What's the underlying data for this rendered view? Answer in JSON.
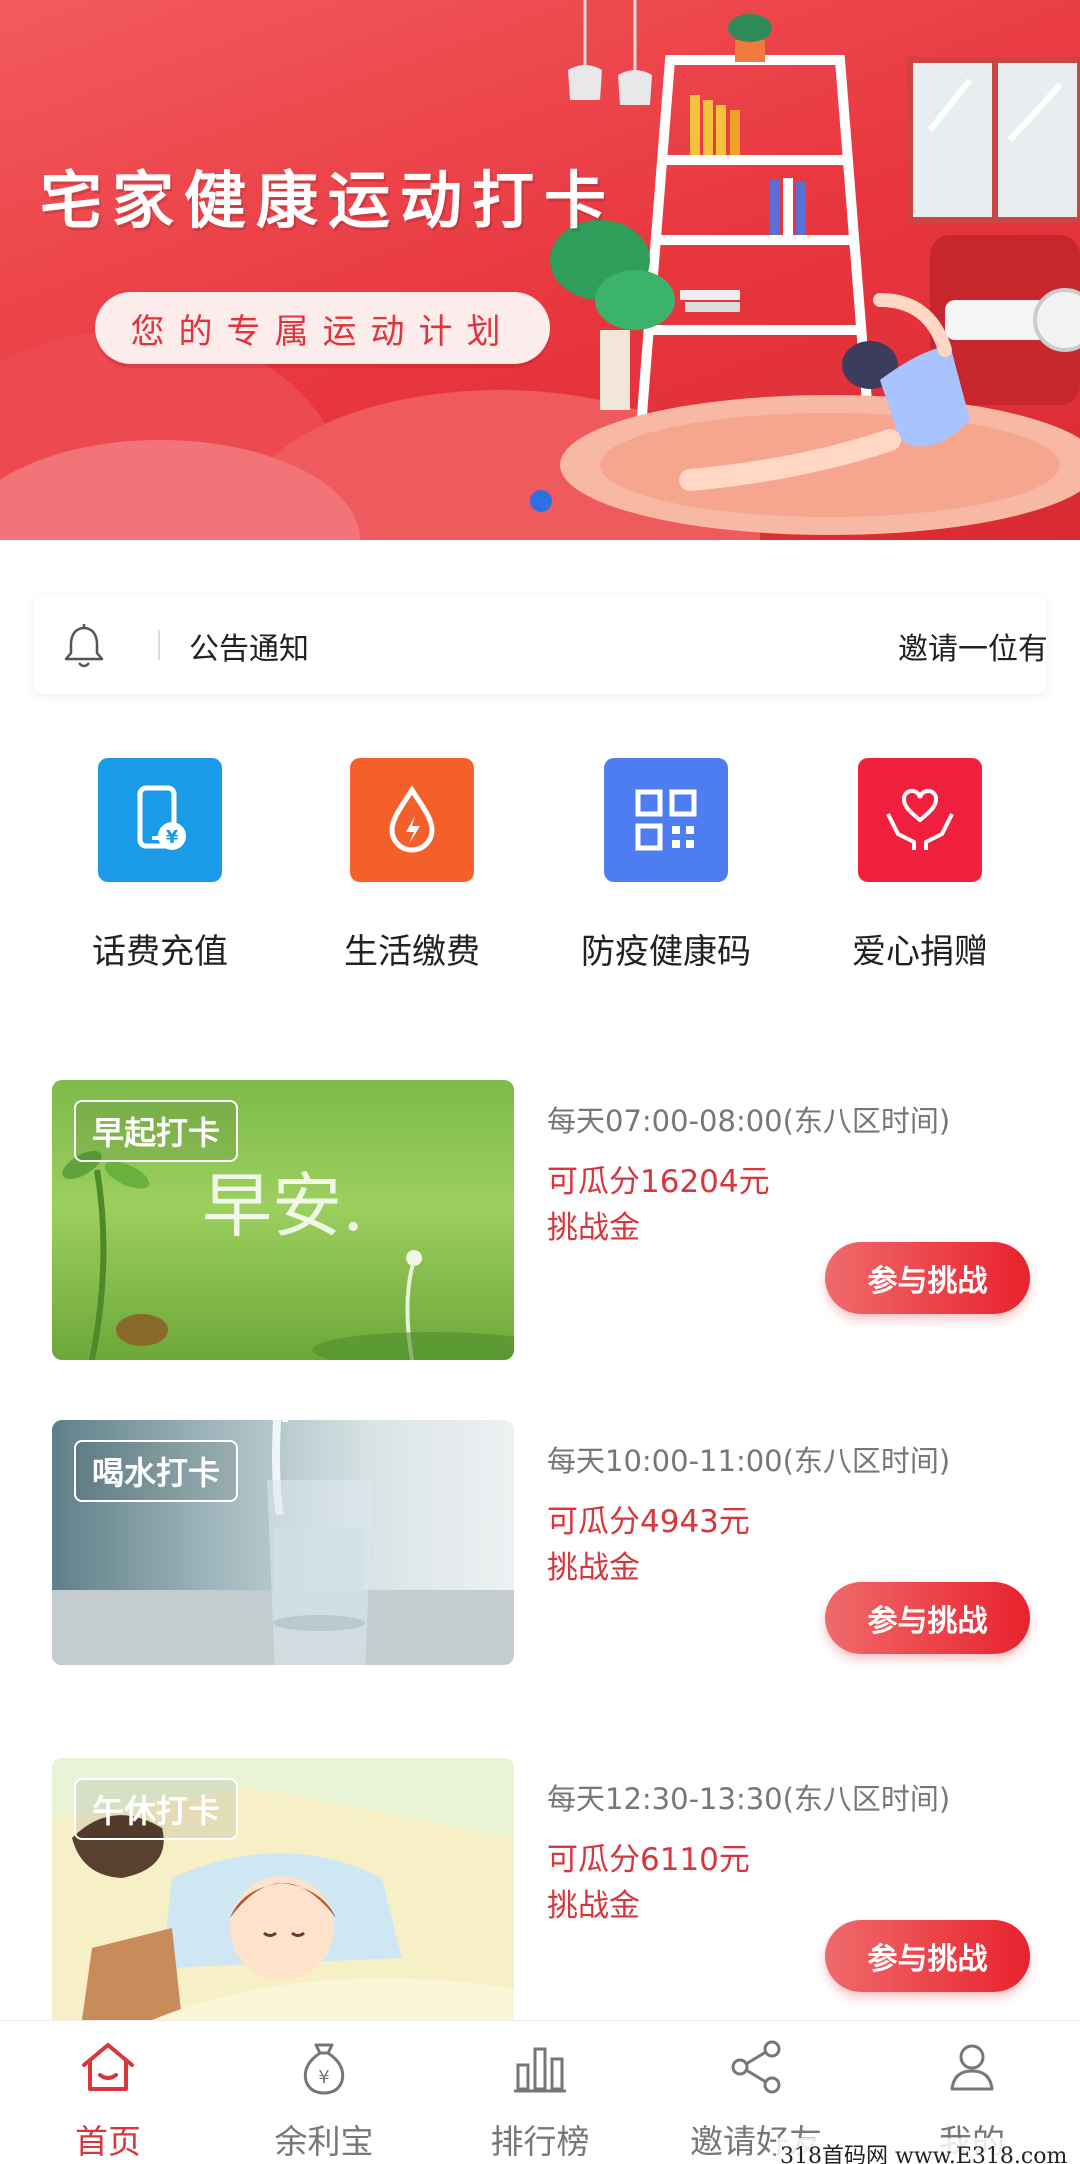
{
  "banner": {
    "title": "宅家健康运动打卡",
    "subtitle": "您的专属运动计划"
  },
  "notice": {
    "label": "公告通知",
    "marquee": "邀请一位有效"
  },
  "services": [
    {
      "label": "话费充值",
      "icon": "phone-recharge-icon",
      "color": "#1a9be8"
    },
    {
      "label": "生活缴费",
      "icon": "water-drop-icon",
      "color": "#f5602a"
    },
    {
      "label": "防疫健康码",
      "icon": "qr-code-icon",
      "color": "#4d7df0"
    },
    {
      "label": "爱心捐赠",
      "icon": "heart-hands-icon",
      "color": "#f0203e"
    }
  ],
  "challenges": [
    {
      "tag": "早起打卡",
      "time": "每天07:00-08:00(东八区时间)",
      "prize": "可瓜分16204元",
      "prize_suffix": "挑战金",
      "button": "参与挑战",
      "image_text": "早安."
    },
    {
      "tag": "喝水打卡",
      "time": "每天10:00-11:00(东八区时间)",
      "prize": "可瓜分4943元",
      "prize_suffix": "挑战金",
      "button": "参与挑战"
    },
    {
      "tag": "午休打卡",
      "time": "每天12:30-13:30(东八区时间)",
      "prize": "可瓜分6110元",
      "prize_suffix": "挑战金",
      "button": "参与挑战"
    }
  ],
  "tabbar": [
    {
      "label": "首页",
      "icon": "home-icon",
      "active": true
    },
    {
      "label": "余利宝",
      "icon": "money-bag-icon",
      "active": false
    },
    {
      "label": "排行榜",
      "icon": "bar-chart-icon",
      "active": false
    },
    {
      "label": "邀请好友",
      "icon": "share-icon",
      "active": false
    },
    {
      "label": "我的",
      "icon": "user-icon",
      "active": false
    }
  ],
  "colors": {
    "accent": "#d8363c",
    "banner": "#e8363e",
    "carousel_dot": "#2f6fe4"
  },
  "watermark": "318首码网 www.E318.com"
}
